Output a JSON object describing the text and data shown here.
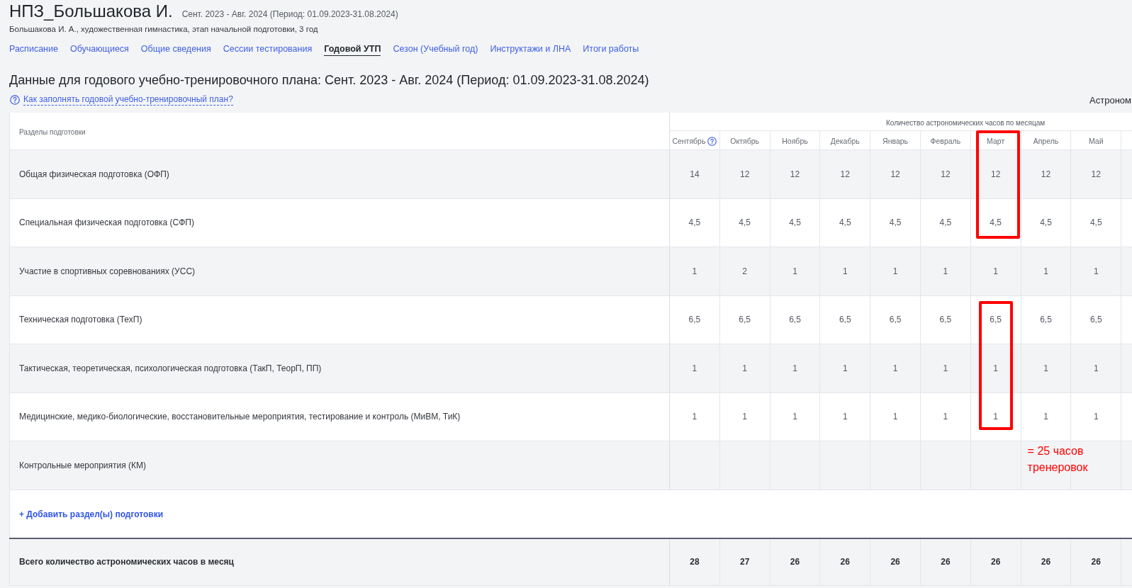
{
  "header": {
    "title": "НПЗ_Большакова И.",
    "period": "Сент. 2023 - Авг. 2024 (Период: 01.09.2023-31.08.2024)",
    "byline": "Большакова И. А., художественная гимнастика, этап начальной подготовки, 3 год"
  },
  "tabs": [
    {
      "label": "Расписание",
      "selected": false
    },
    {
      "label": "Обучающиеся",
      "selected": false
    },
    {
      "label": "Общие сведения",
      "selected": false
    },
    {
      "label": "Сессии тестирования",
      "selected": false
    },
    {
      "label": "Годовой УТП",
      "selected": true
    },
    {
      "label": "Сезон (Учебный год)",
      "selected": false
    },
    {
      "label": "Инструктажи и ЛНА",
      "selected": false
    },
    {
      "label": "Итоги работы",
      "selected": false
    }
  ],
  "section": {
    "heading": "Данные для годового учебно-тренировочного плана: Сент. 2023 - Авг. 2024 (Период: 01.09.2023-31.08.2024)",
    "help_link": "Как заполнять годовой учебно-тренировочный план?",
    "side_label": "Астроном"
  },
  "table": {
    "first_column": "Разделы подготовки",
    "group_heading": "Количество астрономических часов по месяцам",
    "months": [
      {
        "label": "Сентябрь",
        "help": true,
        "annotated": false
      },
      {
        "label": "Октябрь",
        "help": false,
        "annotated": false
      },
      {
        "label": "Ноябрь",
        "help": false,
        "annotated": false
      },
      {
        "label": "Декабрь",
        "help": false,
        "annotated": false
      },
      {
        "label": "Январь",
        "help": false,
        "annotated": false
      },
      {
        "label": "Февраль",
        "help": false,
        "annotated": false
      },
      {
        "label": "Март",
        "help": false,
        "annotated": true
      },
      {
        "label": "Апрель",
        "help": false,
        "annotated": false
      },
      {
        "label": "Май",
        "help": false,
        "annotated": false
      }
    ],
    "rows": [
      {
        "label": "Общая физическая подготовка (ОФП)",
        "values": [
          "14",
          "12",
          "12",
          "12",
          "12",
          "12",
          "12",
          "12",
          "12"
        ]
      },
      {
        "label": "Специальная физическая подготовка (СФП)",
        "values": [
          "4,5",
          "4,5",
          "4,5",
          "4,5",
          "4,5",
          "4,5",
          "4,5",
          "4,5",
          "4,5"
        ]
      },
      {
        "label": "Участие в спортивных соревнованиях (УСС)",
        "values": [
          "1",
          "2",
          "1",
          "1",
          "1",
          "1",
          "1",
          "1",
          "1"
        ]
      },
      {
        "label": "Техническая подготовка (ТехП)",
        "values": [
          "6,5",
          "6,5",
          "6,5",
          "6,5",
          "6,5",
          "6,5",
          "6,5",
          "6,5",
          "6,5"
        ]
      },
      {
        "label": "Тактическая, теоретическая, психологическая подготовка (ТакП, ТеорП, ПП)",
        "values": [
          "1",
          "1",
          "1",
          "1",
          "1",
          "1",
          "1",
          "1",
          "1"
        ]
      },
      {
        "label": "Медицинские, медико-биологические, восстановительные мероприятия, тестирование и контроль (МиВМ, ТиК)",
        "values": [
          "1",
          "1",
          "1",
          "1",
          "1",
          "1",
          "1",
          "1",
          "1"
        ]
      },
      {
        "label": "Контрольные мероприятия (КМ)"
      }
    ],
    "add_link": "+ Добавить раздел(ы) подготовки",
    "totals": {
      "label": "Всего количество астрономических часов в месяц",
      "values": [
        "28",
        "27",
        "26",
        "26",
        "26",
        "26",
        "26",
        "26",
        "26"
      ]
    }
  },
  "annotation": {
    "header_framed": true,
    "note": "= 25 часов тренеровок"
  }
}
